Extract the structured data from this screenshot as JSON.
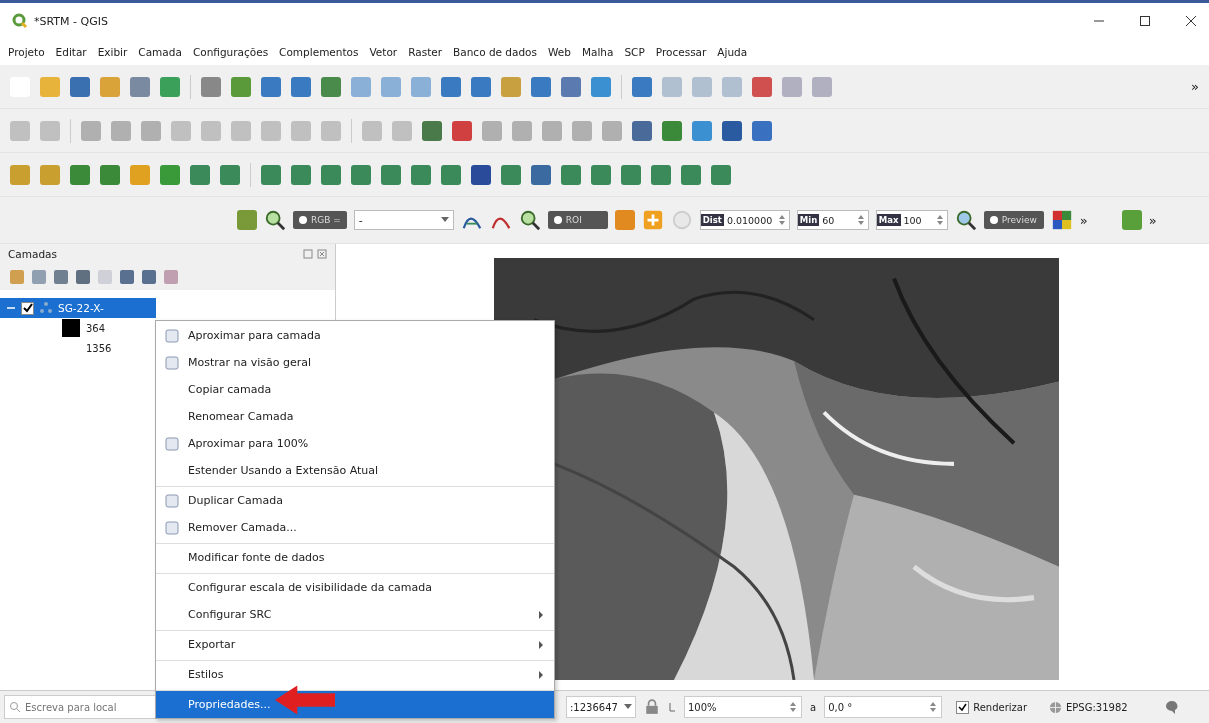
{
  "window": {
    "title": "*SRTM - QGIS"
  },
  "menu_bar": [
    "Projeto",
    "Editar",
    "Exibir",
    "Camada",
    "Configurações",
    "Complementos",
    "Vetor",
    "Raster",
    "Banco de dados",
    "Web",
    "Malha",
    "SCP",
    "Processar",
    "Ajuda"
  ],
  "toolbar_1": {
    "overflow": "»"
  },
  "toolbar_4": {
    "rgb_toggle": "RGB =",
    "band_combo": "-",
    "roi_toggle": "ROI",
    "dist": {
      "label": "Dist",
      "value": "0.010000"
    },
    "min": {
      "label": "Min",
      "value": "60"
    },
    "max": {
      "label": "Max",
      "value": "100"
    },
    "preview_toggle": "Preview",
    "overflow_1": "»",
    "overflow_2": "»"
  },
  "layers_panel": {
    "title": "Camadas",
    "layers": [
      {
        "name": "SG-22-X-",
        "checked": true,
        "selected": true,
        "expanded": true,
        "legend": [
          "364",
          "1356"
        ]
      }
    ]
  },
  "context_menu": {
    "items": [
      {
        "label": "Aproximar para camada",
        "separator_before": false,
        "submenu": false,
        "selected": false
      },
      {
        "label": "Mostrar na visão geral",
        "separator_before": false,
        "submenu": false,
        "selected": false
      },
      {
        "label": "Copiar camada",
        "separator_before": false,
        "submenu": false,
        "selected": false
      },
      {
        "label": "Renomear Camada",
        "separator_before": false,
        "submenu": false,
        "selected": false
      },
      {
        "label": "Aproximar para 100%",
        "separator_before": false,
        "submenu": false,
        "selected": false
      },
      {
        "label": "Estender Usando a Extensão Atual",
        "separator_before": false,
        "submenu": false,
        "selected": false
      },
      {
        "label": "Duplicar Camada",
        "separator_before": true,
        "submenu": false,
        "selected": false
      },
      {
        "label": "Remover Camada...",
        "separator_before": false,
        "submenu": false,
        "selected": false
      },
      {
        "label": "Modificar fonte de dados",
        "separator_before": true,
        "submenu": false,
        "selected": false
      },
      {
        "label": "Configurar escala de visibilidade da camada",
        "separator_before": true,
        "submenu": false,
        "selected": false
      },
      {
        "label": "Configurar SRC",
        "separator_before": false,
        "submenu": true,
        "selected": false
      },
      {
        "label": "Exportar",
        "separator_before": true,
        "submenu": true,
        "selected": false
      },
      {
        "label": "Estilos",
        "separator_before": true,
        "submenu": true,
        "selected": false
      },
      {
        "label": "Propriedades...",
        "separator_before": true,
        "submenu": false,
        "selected": true
      }
    ]
  },
  "status_bar": {
    "search_placeholder": "Escreva para local",
    "scale": ":1236647",
    "magnifier": "100%",
    "rotation_label": "a",
    "rotation": "0,0 °",
    "render": {
      "label": "Renderizar",
      "checked": true
    },
    "crs": "EPSG:31982"
  }
}
